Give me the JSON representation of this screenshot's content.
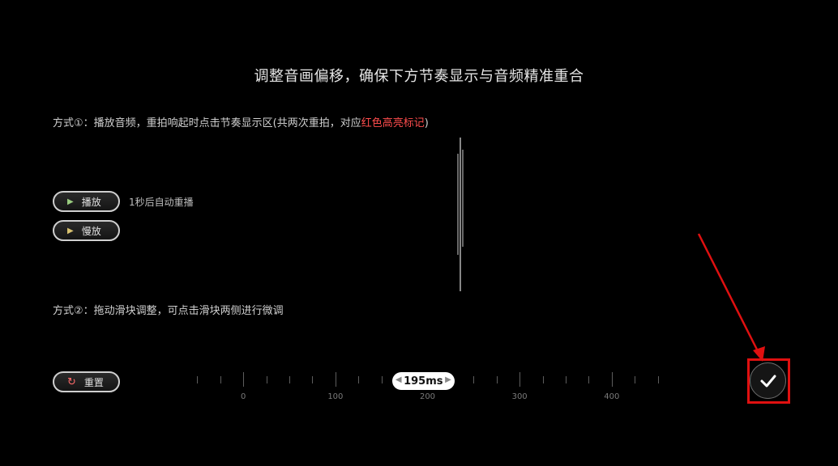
{
  "title": "调整音画偏移，确保下方节奏显示与音频精准重合",
  "method1": {
    "prefix": "方式①：播放音频，重拍响起时点击节奏显示区(共两次重拍，对应",
    "highlight": "红色高亮标记",
    "suffix": ")"
  },
  "buttons": {
    "play": "播放",
    "slow": "慢放",
    "reset": "重置"
  },
  "auto_replay_text": "1秒后自动重播",
  "method2": "方式②：拖动滑块调整，可点击滑块两侧进行微调",
  "slider": {
    "value_label": "195ms",
    "value_ms": 195,
    "min": -75,
    "max": 475,
    "ticks": [
      "0",
      "100",
      "200",
      "300",
      "400"
    ]
  },
  "colors": {
    "highlight": "#ff4d4d",
    "confirm_frame": "#e01010",
    "arrow": "#e01010"
  },
  "icons": {
    "play": "play-icon",
    "slow": "slow-play-icon",
    "reset": "reset-icon",
    "confirm": "check-icon"
  }
}
